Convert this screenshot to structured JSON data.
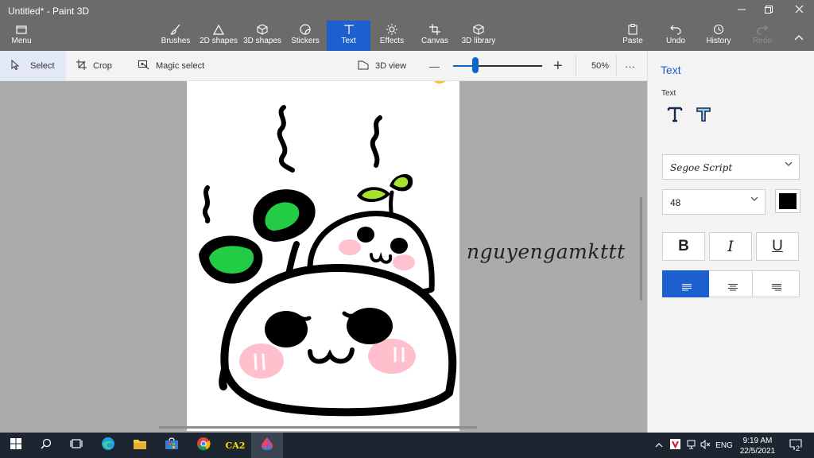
{
  "window": {
    "title": "Untitled* - Paint 3D",
    "controls": [
      "minimize",
      "maximize",
      "close"
    ]
  },
  "ribbon": {
    "menu": {
      "label": "Menu",
      "icon": "folder-icon"
    },
    "tools": [
      {
        "label": "Brushes",
        "icon": "brush-icon"
      },
      {
        "label": "2D shapes",
        "icon": "2d-shapes-icon"
      },
      {
        "label": "3D shapes",
        "icon": "3d-shapes-icon"
      },
      {
        "label": "Stickers",
        "icon": "stickers-icon"
      },
      {
        "label": "Text",
        "icon": "text-icon",
        "active": true
      },
      {
        "label": "Effects",
        "icon": "effects-icon"
      },
      {
        "label": "Canvas",
        "icon": "canvas-icon"
      },
      {
        "label": "3D library",
        "icon": "3d-library-icon"
      }
    ],
    "actions": [
      {
        "label": "Paste",
        "icon": "paste-icon"
      },
      {
        "label": "Undo",
        "icon": "undo-icon"
      },
      {
        "label": "History",
        "icon": "history-icon"
      },
      {
        "label": "Redo",
        "icon": "redo-icon",
        "disabled": true
      }
    ]
  },
  "toolbar": {
    "select": "Select",
    "crop": "Crop",
    "magic_select": "Magic select",
    "view_3d": "3D view",
    "zoom_minus": "—",
    "zoom_plus": "+",
    "zoom_level": "50%",
    "zoom_fraction": 0.25,
    "more": "···"
  },
  "canvas": {
    "text": "nguyengamkttt"
  },
  "panel": {
    "title": "Text",
    "subtitle": "Text",
    "text_types": [
      "2d-text-icon",
      "3d-text-icon"
    ],
    "font_family": "Segoe Script",
    "font_size": "48",
    "color": "#000000",
    "format": {
      "bold": "B",
      "italic": "I",
      "underline": "U"
    },
    "alignment": [
      "align-left-icon",
      "align-center-icon",
      "align-right-icon"
    ],
    "alignment_selected": "left"
  },
  "taskbar": {
    "apps": [
      "windows-start-icon",
      "search-icon",
      "task-view-icon",
      "edge-icon",
      "file-explorer-icon",
      "store-icon",
      "chrome-icon",
      "ca2-icon",
      "paint3d-icon"
    ],
    "ca2_label": "CA2",
    "language": "ENG",
    "time": "9:19 AM",
    "date": "22/5/2021",
    "notifications": "2"
  },
  "colors": {
    "titlebar": "#6b6b6b",
    "accent": "#1e5fd0",
    "leaf": "#22cc44",
    "sprout": "#a6e22e",
    "blush": "#ffb8c8"
  }
}
